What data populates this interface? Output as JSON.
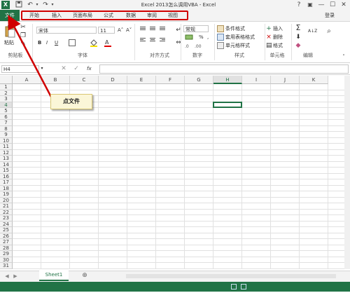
{
  "window": {
    "title": "Excel 2013怎么调用VBA - Excel",
    "help": "?",
    "ribbon_display": "▣",
    "minimize": "—",
    "maximize": "☐",
    "close": "✕"
  },
  "quick_access": {
    "logo": "X",
    "save": "💾",
    "undo": "↶",
    "redo": "↷",
    "customize": "▾"
  },
  "tabs": {
    "file": "文件",
    "items": [
      "开始",
      "插入",
      "页面布局",
      "公式",
      "数据",
      "审阅",
      "视图"
    ],
    "login": "登录"
  },
  "ribbon": {
    "clipboard": {
      "paste": "粘贴",
      "label": "剪贴板"
    },
    "font": {
      "name": "宋体",
      "size": "11",
      "grow": "A˄",
      "shrink": "A˅",
      "bold": "B",
      "italic": "I",
      "underline": "U",
      "label": "字体"
    },
    "alignment": {
      "label": "对齐方式"
    },
    "number": {
      "format": "常规",
      "percent": "%",
      "comma": ",",
      "label": "数字"
    },
    "styles": {
      "conditional": "条件格式",
      "table": "套用表格格式",
      "cell": "单元格样式",
      "label": "样式"
    },
    "cells": {
      "insert": "插入",
      "delete": "删除",
      "format": "格式",
      "label": "单元格"
    },
    "editing": {
      "sum": "Σ",
      "fill": "⬇",
      "clear": "◆",
      "sort": "A↓Z",
      "find": "⌕",
      "label": "编辑"
    }
  },
  "formula_bar": {
    "name_box": "H4",
    "cancel": "✕",
    "enter": "✓",
    "fx": "fx",
    "value": ""
  },
  "grid": {
    "columns": [
      "A",
      "B",
      "C",
      "D",
      "E",
      "F",
      "G",
      "H",
      "I",
      "J",
      "K"
    ],
    "rows": [
      "1",
      "2",
      "3",
      "4",
      "5",
      "6",
      "7",
      "8",
      "9",
      "10",
      "11",
      "12",
      "13",
      "14",
      "15",
      "16",
      "17",
      "18",
      "19",
      "20",
      "21",
      "22",
      "23",
      "24",
      "25",
      "26",
      "27",
      "28",
      "29",
      "30",
      "31"
    ],
    "active_cell": "H4"
  },
  "annotation": {
    "callout": "点文件",
    "highlight_color": "#d00000"
  },
  "sheets": {
    "tabs": [
      "Sheet1"
    ],
    "add": "⊕"
  },
  "colors": {
    "accent": "#217346"
  }
}
